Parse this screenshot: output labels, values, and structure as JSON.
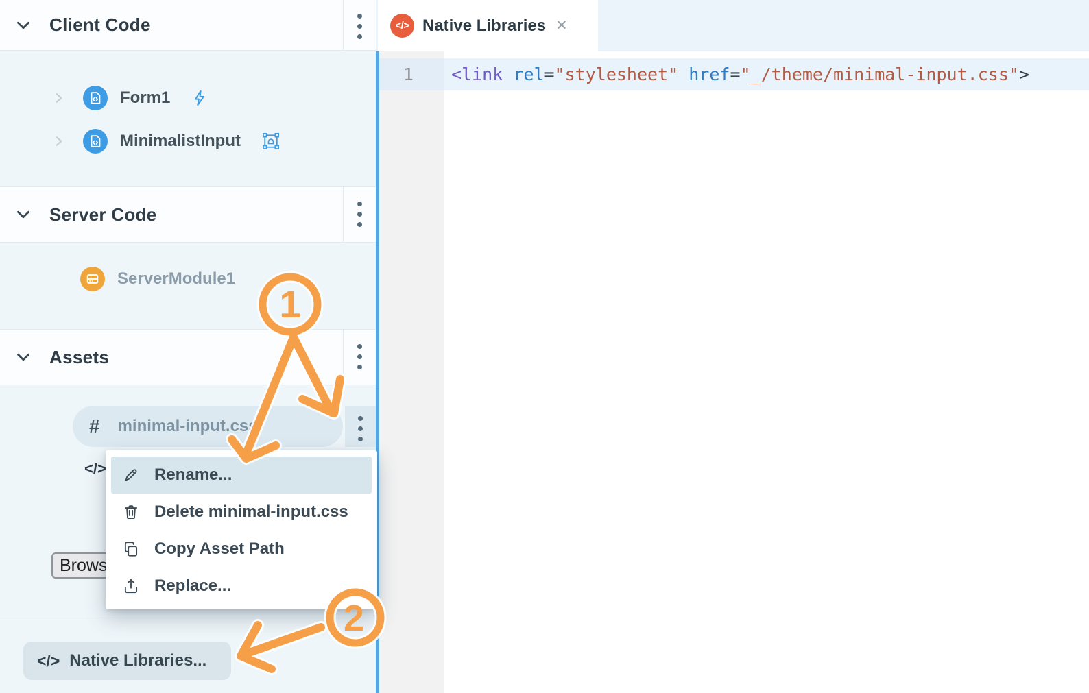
{
  "colors": {
    "annotation_orange": "#F5A049",
    "tab_icon_bg": "#E85D3B",
    "form_icon_blue": "#3D9CE3",
    "server_icon_orange": "#F0A53A",
    "divider_blue": "#55A7E3"
  },
  "sidebar": {
    "sections": [
      {
        "title": "Client Code"
      },
      {
        "title": "Server Code"
      },
      {
        "title": "Assets"
      }
    ],
    "client_items": [
      {
        "label": "Form1"
      },
      {
        "label": "MinimalistInput"
      }
    ],
    "server_items": [
      {
        "label": "ServerModule1"
      }
    ],
    "asset_item": {
      "hash": "#",
      "label": "minimal-input.css"
    },
    "hidden_icon_text": "</>",
    "browse_button": "Brows",
    "native_libraries_button": {
      "icon": "</>",
      "label": "Native Libraries..."
    }
  },
  "context_menu": {
    "items": [
      {
        "label": "Rename..."
      },
      {
        "label": "Delete minimal-input.css"
      },
      {
        "label": "Copy Asset Path"
      },
      {
        "label": "Replace..."
      }
    ]
  },
  "editor": {
    "tab": {
      "label": "Native Libraries",
      "icon_text": "</>",
      "close": "✕"
    },
    "line_number": "1",
    "code_tokens": [
      {
        "text": "<",
        "color": "#715BC9"
      },
      {
        "text": "link",
        "color": "#715BC9"
      },
      {
        "text": " ",
        "color": "#3A4750"
      },
      {
        "text": "rel",
        "color": "#2F7CC4"
      },
      {
        "text": "=",
        "color": "#3A4750"
      },
      {
        "text": "\"stylesheet\"",
        "color": "#B25B44"
      },
      {
        "text": " ",
        "color": "#3A4750"
      },
      {
        "text": "href",
        "color": "#2F7CC4"
      },
      {
        "text": "=",
        "color": "#3A4750"
      },
      {
        "text": "\"_/theme/minimal-input.css\"",
        "color": "#B25B44"
      },
      {
        "text": ">",
        "color": "#323E46"
      }
    ]
  },
  "annotations": {
    "step1": "1",
    "step2": "2"
  }
}
